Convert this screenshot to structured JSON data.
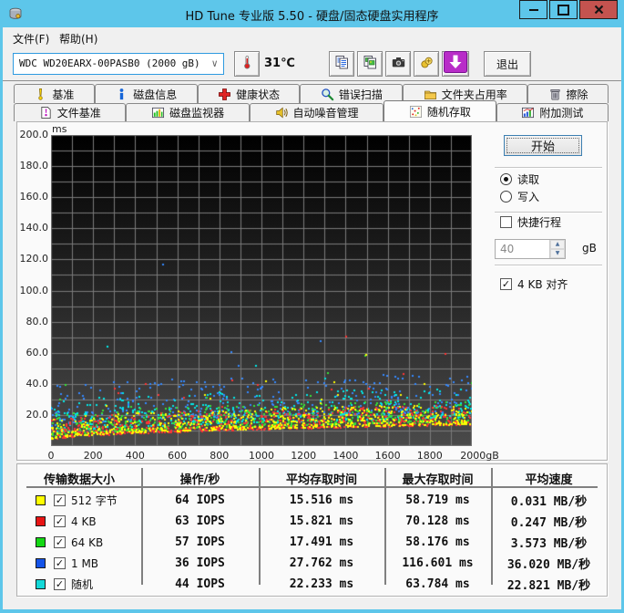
{
  "window": {
    "title": "HD Tune 专业版 5.50 - 硬盘/固态硬盘实用程序"
  },
  "menu": {
    "items": [
      {
        "id": "file",
        "label": "文件(F)"
      },
      {
        "id": "help",
        "label": "帮助(H)"
      }
    ]
  },
  "toolbar": {
    "drive_select": {
      "value": "WDC WD20EARX-00PASB0 (2000 gB)"
    },
    "temperature": "31℃",
    "buttons": [
      {
        "id": "copy-text",
        "icon": "copy-text"
      },
      {
        "id": "copy-image",
        "icon": "copy-image"
      },
      {
        "id": "screenshot",
        "icon": "camera"
      },
      {
        "id": "registration",
        "icon": "gold"
      },
      {
        "id": "update",
        "icon": "update"
      }
    ],
    "exit_label": "退出"
  },
  "tabs": {
    "active_id": "random-access",
    "rows": [
      [
        {
          "id": "benchmark",
          "label": "基准",
          "icon": "benchmark"
        },
        {
          "id": "disk-info",
          "label": "磁盘信息",
          "icon": "disk-info"
        },
        {
          "id": "health",
          "label": "健康状态",
          "icon": "health"
        },
        {
          "id": "error-scan",
          "label": "错误扫描",
          "icon": "error-scan"
        },
        {
          "id": "folder-usage",
          "label": "文件夹占用率",
          "icon": "folder"
        },
        {
          "id": "erase",
          "label": "擦除",
          "icon": "erase"
        }
      ],
      [
        {
          "id": "file-benchmark",
          "label": "文件基准",
          "icon": "file-benchmark"
        },
        {
          "id": "disk-monitor",
          "label": "磁盘监视器",
          "icon": "disk-monitor"
        },
        {
          "id": "noise-management",
          "label": "自动噪音管理",
          "icon": "noise"
        },
        {
          "id": "random-access",
          "label": "随机存取",
          "icon": "random-access"
        },
        {
          "id": "extra-tests",
          "label": "附加测试",
          "icon": "extra-tests"
        }
      ]
    ]
  },
  "panel": {
    "start_label": "开始",
    "read_label": "读取",
    "read_checked": true,
    "write_label": "写入",
    "write_checked": false,
    "short_stroke_label": "快捷行程",
    "short_stroke_checked": false,
    "short_stroke_value": "40",
    "short_stroke_unit": "gB",
    "align_label": "4 KB 对齐",
    "align_checked": true
  },
  "chart_data": {
    "type": "scatter",
    "ylabel": "ms",
    "xlim": [
      0,
      2000
    ],
    "ylim": [
      0,
      200
    ],
    "x_ticks": [
      "0",
      "200",
      "400",
      "600",
      "800",
      "1000",
      "1200",
      "1400",
      "1600",
      "1800",
      "2000gB"
    ],
    "y_ticks": [
      "200.0",
      "180.0",
      "160.0",
      "140.0",
      "120.0",
      "100.0",
      "80.0",
      "60.0",
      "40.0",
      "20.0"
    ],
    "grid": {
      "x_step": 100,
      "y_step": 10,
      "on": true
    },
    "background_gradient": [
      "#000000",
      "#4a4a4a"
    ],
    "gridline_color": "#7a7a7a",
    "seed": 1337,
    "envelope": {
      "base_ms": 3,
      "rise_ms": 10
    },
    "series": [
      {
        "name": "512 字节",
        "color": "#ffff00",
        "points": 640,
        "band_base_ms": 1.0,
        "band_spread_ms": 13,
        "outlier_rate": 0.02,
        "outlier_extra_ms": 25,
        "avg_ms": 15.516,
        "max_ms": 58.719,
        "draw_order": 4
      },
      {
        "name": "4 KB",
        "color": "#ff3434",
        "points": 630,
        "band_base_ms": 0.5,
        "band_spread_ms": 13,
        "outlier_rate": 0.02,
        "outlier_extra_ms": 35,
        "avg_ms": 15.821,
        "max_ms": 70.128,
        "draw_order": 3
      },
      {
        "name": "64 KB",
        "color": "#36e436",
        "points": 570,
        "band_base_ms": 2.5,
        "band_spread_ms": 14,
        "outlier_rate": 0.02,
        "outlier_extra_ms": 28,
        "avg_ms": 17.491,
        "max_ms": 58.176,
        "draw_order": 2
      },
      {
        "name": "1 MB",
        "color": "#3388ff",
        "points": 360,
        "band_base_ms": 9.0,
        "band_spread_ms": 26,
        "outlier_rate": 0.05,
        "outlier_extra_ms": 25,
        "avg_ms": 27.762,
        "max_ms": 116.601,
        "draw_order": 0
      },
      {
        "name": "随机",
        "color": "#00e8e8",
        "points": 440,
        "band_base_ms": 5.0,
        "band_spread_ms": 20,
        "outlier_rate": 0.03,
        "outlier_extra_ms": 22,
        "avg_ms": 22.233,
        "max_ms": 63.784,
        "draw_order": 1
      }
    ]
  },
  "table": {
    "headers": [
      "传输数据大小",
      "操作/秒",
      "平均存取时间",
      "最大存取时间",
      "平均速度"
    ],
    "rows": [
      {
        "color": "#ffff00",
        "checked": true,
        "label": "512 字节",
        "ops": "64 IOPS",
        "avg": "15.516 ms",
        "max": "58.719 ms",
        "speed": "0.031 MB/秒"
      },
      {
        "color": "#e81414",
        "checked": true,
        "label": "4 KB",
        "ops": "63 IOPS",
        "avg": "15.821 ms",
        "max": "70.128 ms",
        "speed": "0.247 MB/秒"
      },
      {
        "color": "#14d814",
        "checked": true,
        "label": "64 KB",
        "ops": "57 IOPS",
        "avg": "17.491 ms",
        "max": "58.176 ms",
        "speed": "3.573 MB/秒"
      },
      {
        "color": "#1453e8",
        "checked": true,
        "label": "1 MB",
        "ops": "36 IOPS",
        "avg": "27.762 ms",
        "max": "116.601 ms",
        "speed": "36.020 MB/秒"
      },
      {
        "color": "#14d8d8",
        "checked": true,
        "label": "随机",
        "ops": "44 IOPS",
        "avg": "22.233 ms",
        "max": "63.784 ms",
        "speed": "22.821 MB/秒"
      }
    ]
  }
}
